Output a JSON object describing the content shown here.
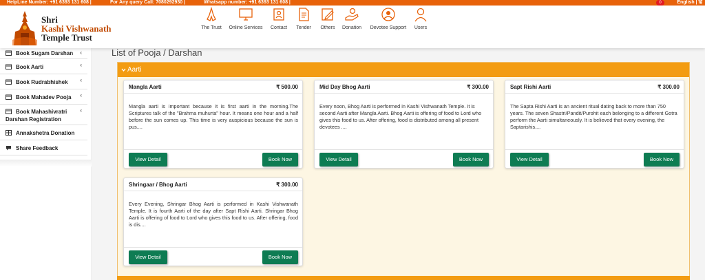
{
  "topbar": {
    "helpline": "HelpLine Number: +91 6393 131 608 |",
    "query": "For Any query Call: 7080292930 |",
    "whatsapp": "Whatsapp number: +91 6393 131 608 |",
    "notif_count": "0",
    "lang": "English | हिं"
  },
  "logo": {
    "line1": "Shri",
    "line2": "Kashi Vishwanath",
    "line3": "Temple Trust"
  },
  "nav": [
    {
      "label": "The Trust",
      "icon": "namaste-hands-icon"
    },
    {
      "label": "Online Services",
      "icon": "computer-monitor-icon"
    },
    {
      "label": "Contact",
      "icon": "contact-phone-icon"
    },
    {
      "label": "Tender",
      "icon": "tender-document-icon"
    },
    {
      "label": "Others",
      "icon": "edit-note-icon"
    },
    {
      "label": "Donation",
      "icon": "donation-hand-icon"
    },
    {
      "label": "Devotee Support",
      "icon": "support-agent-icon"
    },
    {
      "label": "Users",
      "icon": "user-icon"
    }
  ],
  "sidebar": [
    {
      "label": "Book Sugam Darshan",
      "icon": "calendar-icon",
      "chevron": "‹"
    },
    {
      "label": "Book Aarti",
      "icon": "calendar-icon",
      "chevron": "‹"
    },
    {
      "label": "Book Rudrabhishek",
      "icon": "calendar-icon",
      "chevron": "‹"
    },
    {
      "label": "Book Mahadev Pooja",
      "icon": "calendar-icon",
      "chevron": "‹"
    },
    {
      "label": "Book Mahashivratri",
      "label2": "Darshan Registration",
      "icon": "calendar-icon",
      "chevron": "‹"
    },
    {
      "label": "Annakshetra Donation",
      "icon": "grid-icon"
    },
    {
      "label": "Share Feedback",
      "icon": "chat-bubble-icon"
    }
  ],
  "page_title": "List of Pooja / Darshan",
  "section": {
    "title": "Aarti",
    "toggle_icon": "chevron-down-icon"
  },
  "cards": [
    {
      "title": "Mangla Aarti",
      "price": "₹ 500.00",
      "desc": "Mangla aarti is important because it is first aarti in the morning.The Scriptures talk of the \"Brahma muhurta\" hour. It means one hour and a half before the sun comes up. This time is very auspicious because the sun is pus....",
      "view": "View Detail",
      "book": "Book Now"
    },
    {
      "title": "Mid Day Bhog Aarti",
      "price": "₹ 300.00",
      "desc": "Every noon, Bhog Aarti is performed in Kashi Vishwanath Temple. It is second Aarti after Mangla Aarti. Bhog Aarti is offering of food to Lord who gives this food to us. After offering, food is distributed among all present devotees ....",
      "view": "View Detail",
      "book": "Book Now"
    },
    {
      "title": "Sapt Rishi Aarti",
      "price": "₹ 300.00",
      "desc": "The Sapta Rishi Aarti is an ancient ritual dating back to more than 750 years. The seven Shastri/Pandit/Purohit each belonging to a different Gotra perform the Aarti simultaneously. It is believed that every evening, the Saptarishis....",
      "view": "View Detail",
      "book": "Book Now"
    },
    {
      "title": "Shringaar / Bhog Aarti",
      "price": "₹ 300.00",
      "desc": "Every Evening, Shringar Bhog Aarti is performed in Kashi Vishwanath Temple. It is fourth Aarti of the day after Sapt Rishi Aarti. Shringar Bhog Aarti is offering of food to Lord who gives this food to us. After offering, food is dis....",
      "view": "View Detail",
      "book": "Book Now"
    }
  ],
  "colors": {
    "brand_orange": "#e8620a",
    "section_orange": "#f39c12",
    "button_green": "#0e7c53",
    "logo_maroon": "#c14a00"
  }
}
